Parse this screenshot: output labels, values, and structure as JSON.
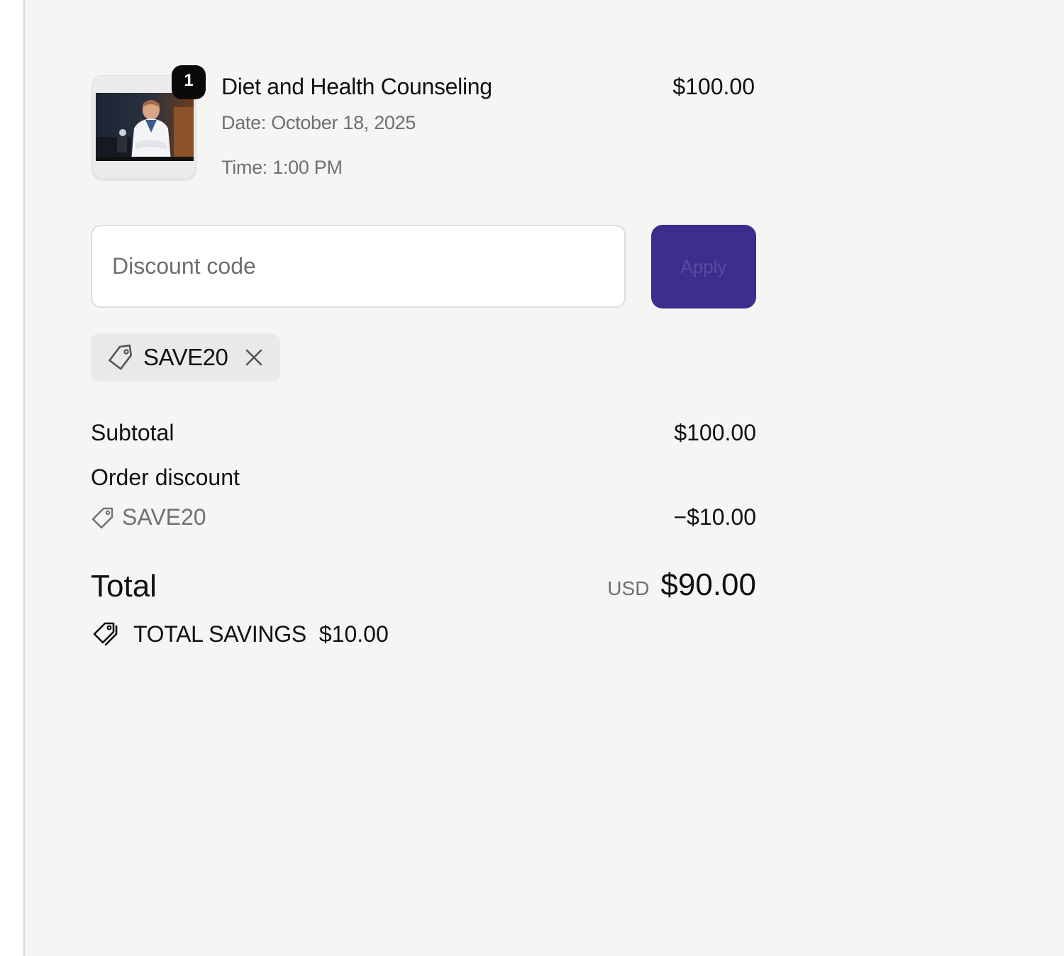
{
  "order": {
    "item": {
      "quantity": "1",
      "title": "Diet and Health Counseling",
      "date": "Date: October 18, 2025",
      "time": "Time: 1:00 PM",
      "price": "$100.00",
      "thumbnail": "counselor-photo"
    },
    "discount": {
      "placeholder": "Discount code",
      "value": "",
      "apply_label": "Apply",
      "applied_code": "SAVE20"
    },
    "totals": {
      "subtotal_label": "Subtotal",
      "subtotal_value": "$100.00",
      "order_discount_label": "Order discount",
      "discount_code": "SAVE20",
      "discount_value": "−$10.00",
      "total_label": "Total",
      "currency": "USD",
      "total_value": "$90.00",
      "savings_label": "TOTAL SAVINGS",
      "savings_value": "$10.00"
    }
  },
  "icons": {
    "tag": "tag-icon",
    "remove": "close-icon",
    "tags": "tags-icon"
  },
  "colors": {
    "background": "#f5f5f4",
    "accent": "#3e2d8c",
    "chip_background": "#e9e9e8",
    "muted_text": "#707070"
  }
}
